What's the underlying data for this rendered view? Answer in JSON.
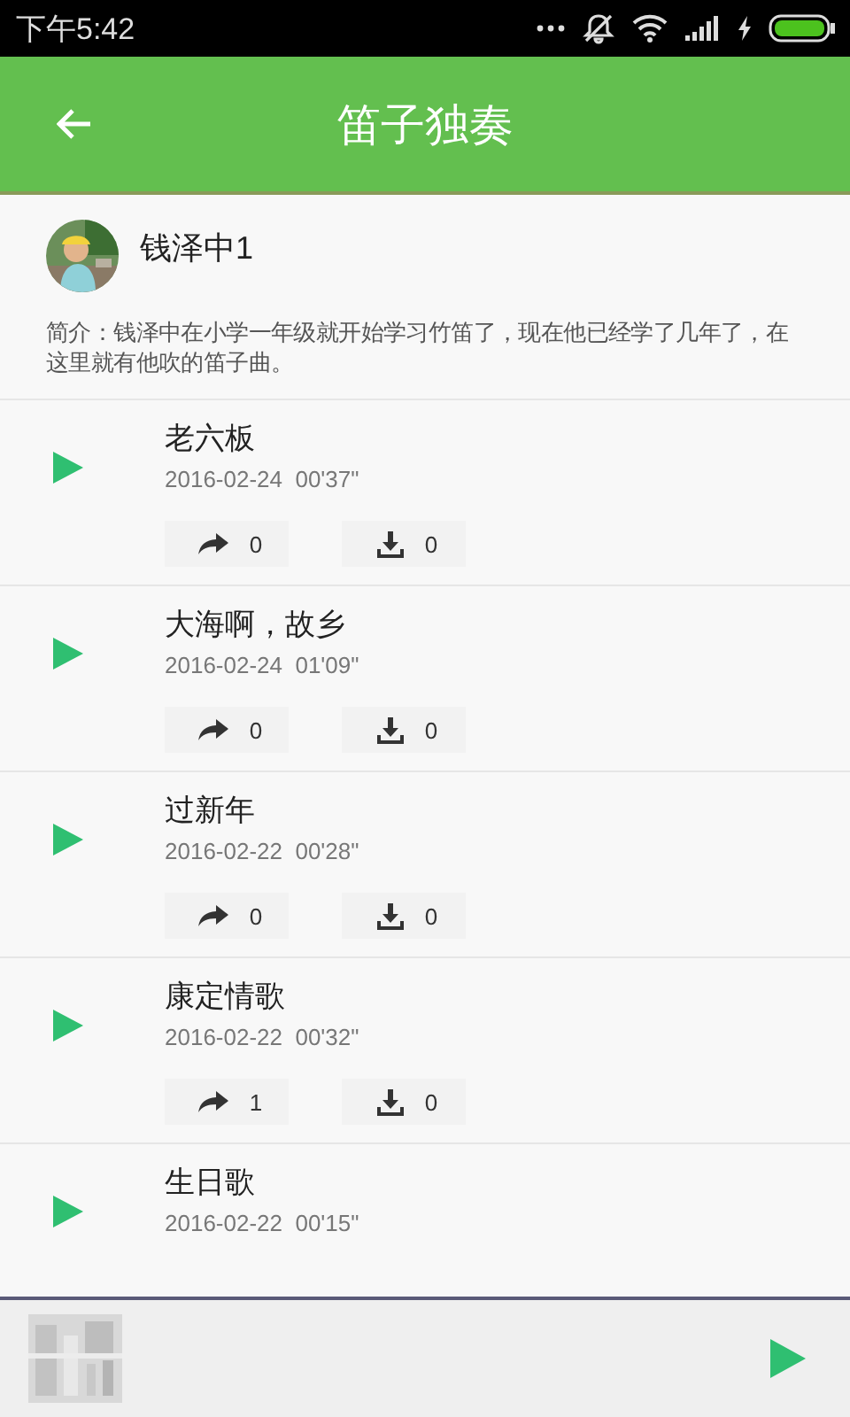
{
  "status_bar": {
    "time": "下午5:42"
  },
  "app_bar": {
    "title": "笛子独奏"
  },
  "profile": {
    "name": "钱泽中1",
    "bio": "简介：钱泽中在小学一年级就开始学习竹笛了，现在他已经学了几年了，在这里就有他吹的笛子曲。"
  },
  "tracks": [
    {
      "title": "老六板",
      "meta": "2016-02-24  00'37\"",
      "shares": "0",
      "downloads": "0"
    },
    {
      "title": "大海啊，故乡",
      "meta": "2016-02-24  01'09\"",
      "shares": "0",
      "downloads": "0"
    },
    {
      "title": "过新年",
      "meta": "2016-02-22  00'28\"",
      "shares": "0",
      "downloads": "0"
    },
    {
      "title": "康定情歌",
      "meta": "2016-02-22  00'32\"",
      "shares": "1",
      "downloads": "0"
    },
    {
      "title": "生日歌",
      "meta": "2016-02-22  00'15\""
    }
  ]
}
